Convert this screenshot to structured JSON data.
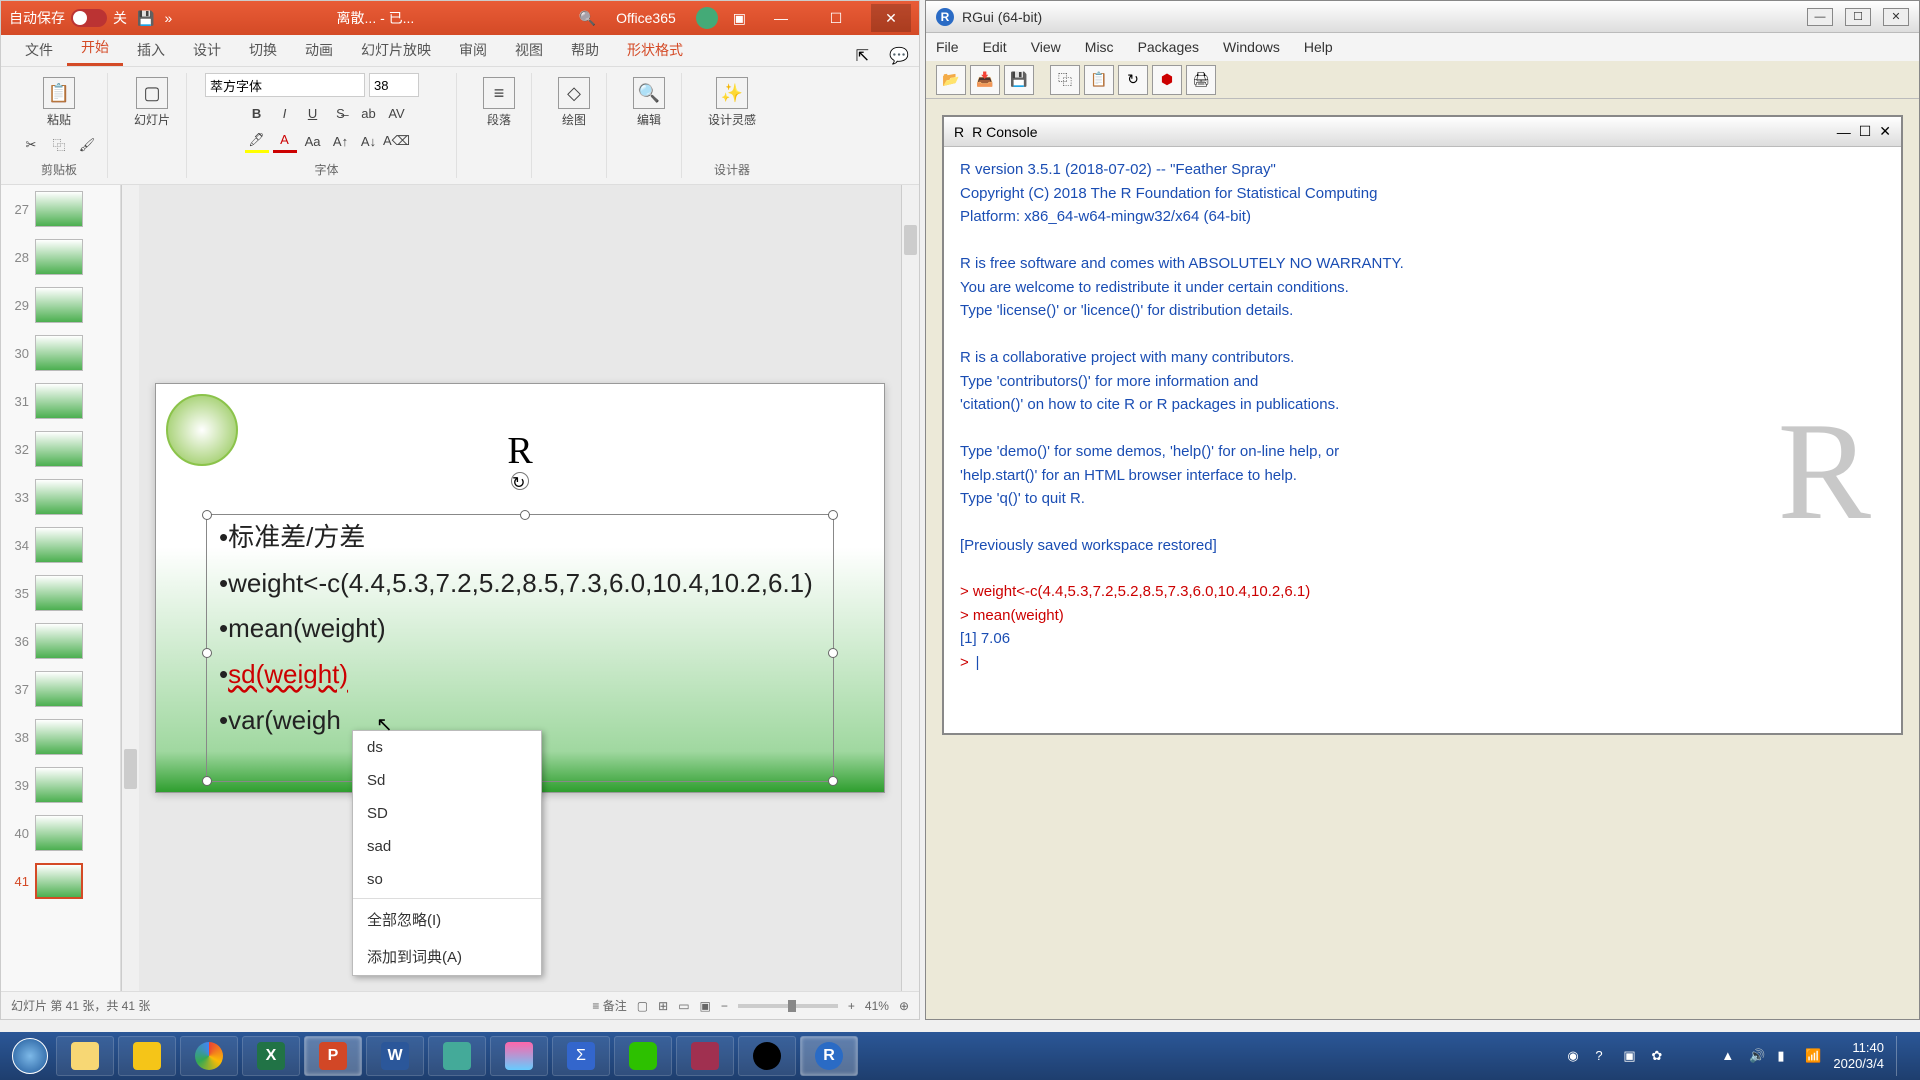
{
  "ppt": {
    "autosave_label": "自动保存",
    "autosave_state": "关",
    "doc_title": "离散... - 已...",
    "brand": "Office365",
    "tabs": {
      "file": "文件",
      "home": "开始",
      "insert": "插入",
      "design": "设计",
      "transition": "切换",
      "animation": "动画",
      "slideshow": "幻灯片放映",
      "review": "审阅",
      "view": "视图",
      "help": "帮助",
      "shape_format": "形状格式"
    },
    "ribbon": {
      "clipboard": "剪贴板",
      "paste": "粘贴",
      "slides": "幻灯片",
      "new_slide": "幻灯片",
      "font_group": "字体",
      "font_name": "萃方字体",
      "font_size": "38",
      "paragraph": "段落",
      "drawing": "绘图",
      "editing": "编辑",
      "designer": "设计灵感",
      "designer_label": "设计器"
    },
    "thumbs": [
      {
        "n": "27"
      },
      {
        "n": "28"
      },
      {
        "n": "29"
      },
      {
        "n": "30"
      },
      {
        "n": "31"
      },
      {
        "n": "32"
      },
      {
        "n": "33"
      },
      {
        "n": "34"
      },
      {
        "n": "35"
      },
      {
        "n": "36"
      },
      {
        "n": "37"
      },
      {
        "n": "38"
      },
      {
        "n": "39"
      },
      {
        "n": "40"
      },
      {
        "n": "41"
      }
    ],
    "slide": {
      "title": "R",
      "bullets": {
        "b1": "标准差/方差",
        "b2": "weight<-c(4.4,5.3,7.2,5.2,8.5,7.3,6.0,10.4,10.2,6.1)",
        "b3": "mean(weight)",
        "b4": "sd(weight)",
        "b5": "var(weigh"
      }
    },
    "context_menu": {
      "i1": "ds",
      "i2": "Sd",
      "i3": "SD",
      "i4": "sad",
      "i5": "so",
      "ignore": "全部忽略(I)",
      "add_dict": "添加到词典(A)"
    },
    "status": {
      "slide_info": "幻灯片 第 41 张，共 41 张",
      "notes": "备注",
      "zoom": "41%"
    }
  },
  "rgui": {
    "title": "RGui (64-bit)",
    "menu": {
      "file": "File",
      "edit": "Edit",
      "view": "View",
      "misc": "Misc",
      "packages": "Packages",
      "windows": "Windows",
      "help": "Help"
    },
    "console_title": "R Console",
    "banner": "R version 3.5.1 (2018-07-02) -- \"Feather Spray\"\nCopyright (C) 2018 The R Foundation for Statistical Computing\nPlatform: x86_64-w64-mingw32/x64 (64-bit)\n\nR is free software and comes with ABSOLUTELY NO WARRANTY.\nYou are welcome to redistribute it under certain conditions.\nType 'license()' or 'licence()' for distribution details.\n\nR is a collaborative project with many contributors.\nType 'contributors()' for more information and\n'citation()' on how to cite R or R packages in publications.\n\nType 'demo()' for some demos, 'help()' for on-line help, or\n'help.start()' for an HTML browser interface to help.\nType 'q()' to quit R.\n\n[Previously saved workspace restored]\n",
    "input1": "> weight<-c(4.4,5.3,7.2,5.2,8.5,7.3,6.0,10.4,10.2,6.1)",
    "input2": "> mean(weight)",
    "output1": "[1] 7.06",
    "prompt": "> ",
    "watermark": "R"
  },
  "taskbar": {
    "time": "11:40",
    "date": "2020/3/4"
  }
}
